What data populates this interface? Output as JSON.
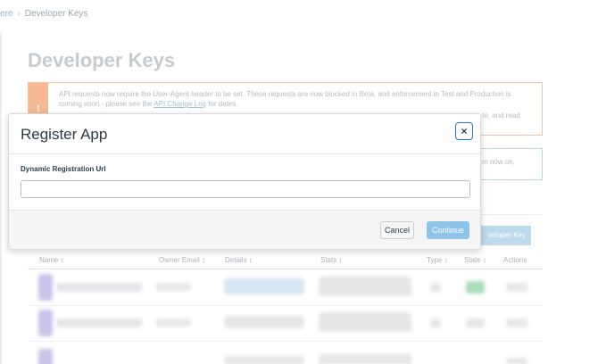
{
  "breadcrumb": {
    "previous": "ere",
    "current": "Developer Keys"
  },
  "page": {
    "title": "Developer Keys",
    "warning_text_1": "API requests now require the User-Agent header to be set. These requests are now blocked in Beta, and enforcement in Test and Production is coming soon - please see the ",
    "warning_link": "API Change Log",
    "warning_text_2": " for dates.",
    "warning_tail": "te, and read",
    "warning_icon": "!",
    "info_tail": "m now on,",
    "devkey_button_label": "veloper Key"
  },
  "table": {
    "headers": [
      "Name ↕",
      "Owner Email ↕",
      "Details ↕",
      "Stats ↕",
      "Type ↕",
      "State ↕",
      "Actions"
    ]
  },
  "modal": {
    "title": "Register App",
    "close_icon": "×",
    "field_label": "Dynamic Registration Url",
    "field_value": "",
    "field_placeholder": "",
    "cancel_label": "Cancel",
    "continue_label": "Continue"
  },
  "colors": {
    "primary_button": "#8fc4ea",
    "close_border": "#2b6fbd",
    "warning_bar": "#f6b992",
    "info_border": "#b9d5ea"
  }
}
